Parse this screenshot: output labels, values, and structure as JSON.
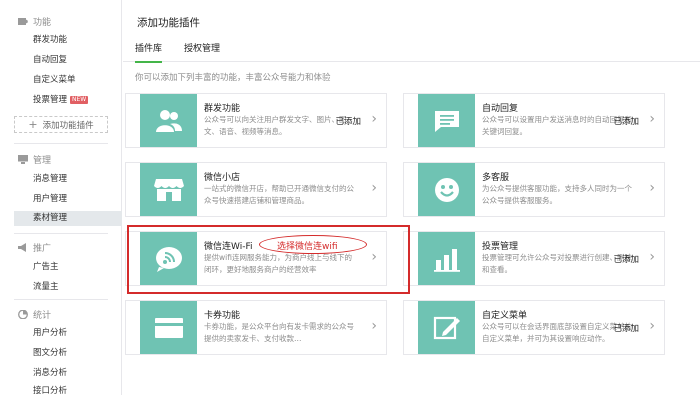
{
  "sidebar": {
    "sections": [
      {
        "title": "功能",
        "icon": "puzzle-icon"
      },
      {
        "title": "管理",
        "icon": "monitor-icon"
      },
      {
        "title": "推广",
        "icon": "megaphone-icon"
      },
      {
        "title": "统计",
        "icon": "chart-icon"
      }
    ],
    "feature_items": [
      "群发功能",
      "自动回复",
      "自定义菜单",
      "投票管理"
    ],
    "new_badge": "NEW",
    "add_plugin": "添加功能插件",
    "manage_items": [
      "消息管理",
      "用户管理",
      "素材管理"
    ],
    "promo_items": [
      "广告主",
      "流量主"
    ],
    "stats_items": [
      "用户分析",
      "图文分析",
      "消息分析",
      "接口分析"
    ]
  },
  "main": {
    "title": "添加功能插件",
    "tabs": [
      "插件库",
      "授权管理"
    ],
    "intro": "你可以添加下列丰富的功能，丰富公众号能力和体验",
    "cards": [
      {
        "name": "群发功能",
        "desc": "公众号可以向关注用户群发文字、图片、图文、语音、视频等消息。",
        "status": "已添加",
        "icon": "users-icon"
      },
      {
        "name": "自动回复",
        "desc": "公众号可以设置用户发送消息时的自动回复和关键词回复。",
        "status": "已添加",
        "icon": "message-icon"
      },
      {
        "name": "微信小店",
        "desc": "一站式的微信开店，帮助已开通微信支付的公众号快速搭建店铺和管理商品。",
        "status": "",
        "icon": "store-icon"
      },
      {
        "name": "多客服",
        "desc": "为公众号提供客服功能，支持多人同时为一个公众号提供客服服务。",
        "status": "",
        "icon": "smile-icon"
      },
      {
        "name": "微信连Wi-Fi",
        "desc": "提供wifi连网服务能力，为商户线上与线下的闭环，更好地服务商户的经营效率",
        "status": "",
        "icon": "wifi-icon"
      },
      {
        "name": "投票管理",
        "desc": "投票管理可允许公众号对投票进行创建、删除和查看。",
        "status": "已添加",
        "icon": "bars-icon"
      },
      {
        "name": "卡券功能",
        "desc": "卡券功能，是公众平台向有发卡需求的公众号提供的卖家发卡、支付收款…",
        "status": "",
        "icon": "card-icon"
      },
      {
        "name": "自定义菜单",
        "desc": "公众号可以在会话界面底部设置自定义菜单的自定义菜单，并可为其设置响应动作。",
        "status": "已添加",
        "icon": "edit-icon"
      }
    ],
    "annotation": "选择微信连wifi"
  },
  "colors": {
    "accent": "#44b549",
    "icon_bg": "#6fc3b3",
    "annotation": "#d42b2b",
    "active_bg": "#e4e8eb"
  }
}
